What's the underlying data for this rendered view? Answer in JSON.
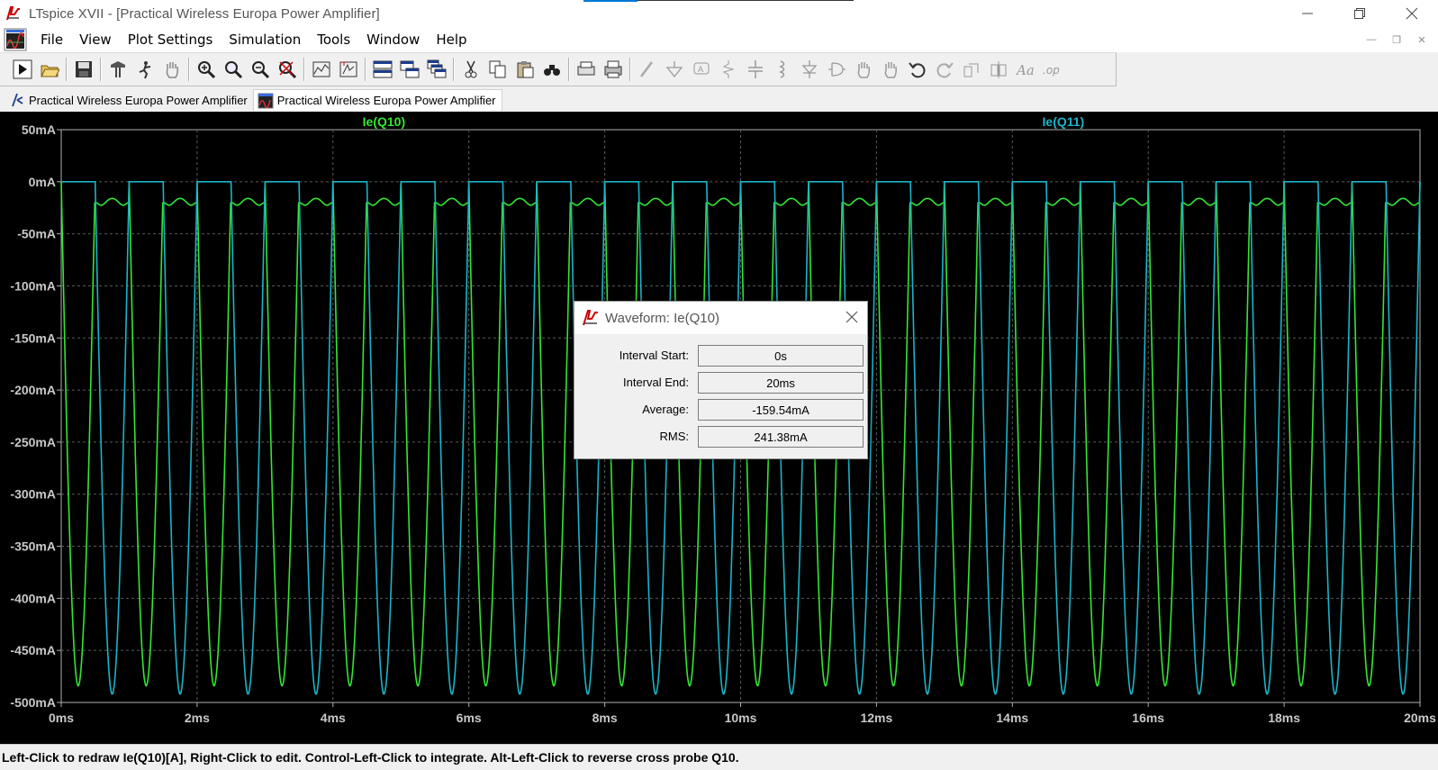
{
  "window": {
    "title": "LTspice XVII - [Practical Wireless Europa Power Amplifier]",
    "minimize_icon": "minimize-icon",
    "maximize_icon": "restore-icon",
    "close_icon": "close-icon"
  },
  "menu": {
    "items": [
      "File",
      "View",
      "Plot Settings",
      "Simulation",
      "Tools",
      "Window",
      "Help"
    ]
  },
  "toolbar": {
    "icons": [
      "run-icon",
      "open-icon",
      "save-icon",
      "control-panel-icon",
      "halt-icon",
      "pan-hand-icon",
      "zoom-area-icon",
      "zoom-in-icon",
      "zoom-out-icon",
      "zoom-fit-icon",
      "autorange-icon",
      "manual-limits-icon",
      "tile-horizontal-icon",
      "tile-vertical-icon",
      "cascade-icon",
      "cut-icon",
      "copy-icon",
      "paste-icon",
      "find-icon",
      "print-preview-icon",
      "print-icon",
      "wire-icon",
      "ground-icon",
      "label-icon",
      "resistor-icon",
      "capacitor-icon",
      "inductor-icon",
      "diode-icon",
      "component-icon",
      "move-icon",
      "drag-icon",
      "undo-icon",
      "redo-icon",
      "rotate-icon",
      "mirror-icon",
      "text-icon",
      "spice-directive-icon"
    ]
  },
  "tabs": [
    {
      "label": "Practical Wireless Europa Power Amplifier",
      "icon": "schematic-icon",
      "active": false
    },
    {
      "label": "Practical Wireless Europa Power Amplifier",
      "icon": "waveform-icon",
      "active": true
    }
  ],
  "colors": {
    "trace_q10": "#33e633",
    "trace_q11": "#1ab4c8",
    "plot_bg": "#000000",
    "grid": "#5a5a5a",
    "tick_text": "#c8c8c8"
  },
  "chart_data": {
    "type": "line",
    "title": "",
    "xlabel": "",
    "ylabel": "",
    "x_ticks": [
      "0ms",
      "2ms",
      "4ms",
      "6ms",
      "8ms",
      "10ms",
      "12ms",
      "14ms",
      "16ms",
      "18ms",
      "20ms"
    ],
    "y_ticks": [
      "50mA",
      "0mA",
      "-50mA",
      "-100mA",
      "-150mA",
      "-200mA",
      "-250mA",
      "-300mA",
      "-350mA",
      "-400mA",
      "-450mA",
      "-500mA"
    ],
    "xlim": [
      0,
      20
    ],
    "ylim": [
      -500,
      50
    ],
    "x_unit": "ms",
    "y_unit": "mA",
    "grid": true,
    "series": [
      {
        "name": "Ie(Q10)",
        "color": "#33e633",
        "frequency_khz": 1.0,
        "peak_ma": -484,
        "offset_ma": -8,
        "phase_ms": 0.0
      },
      {
        "name": "Ie(Q11)",
        "color": "#1ab4c8",
        "frequency_khz": 1.0,
        "peak_ma": -492,
        "offset_ma": 0,
        "phase_ms": 0.5
      }
    ]
  },
  "dialog": {
    "title": "Waveform: Ie(Q10)",
    "rows": [
      {
        "label": "Interval Start:",
        "value": "0s"
      },
      {
        "label": "Interval End:",
        "value": "20ms"
      },
      {
        "label": "Average:",
        "value": "-159.54mA"
      },
      {
        "label": "RMS:",
        "value": "241.38mA"
      }
    ]
  },
  "status": {
    "text": "Left-Click to redraw Ie(Q10)[A],  Right-Click to edit. Control-Left-Click to integrate. Alt-Left-Click to reverse cross probe Q10."
  }
}
